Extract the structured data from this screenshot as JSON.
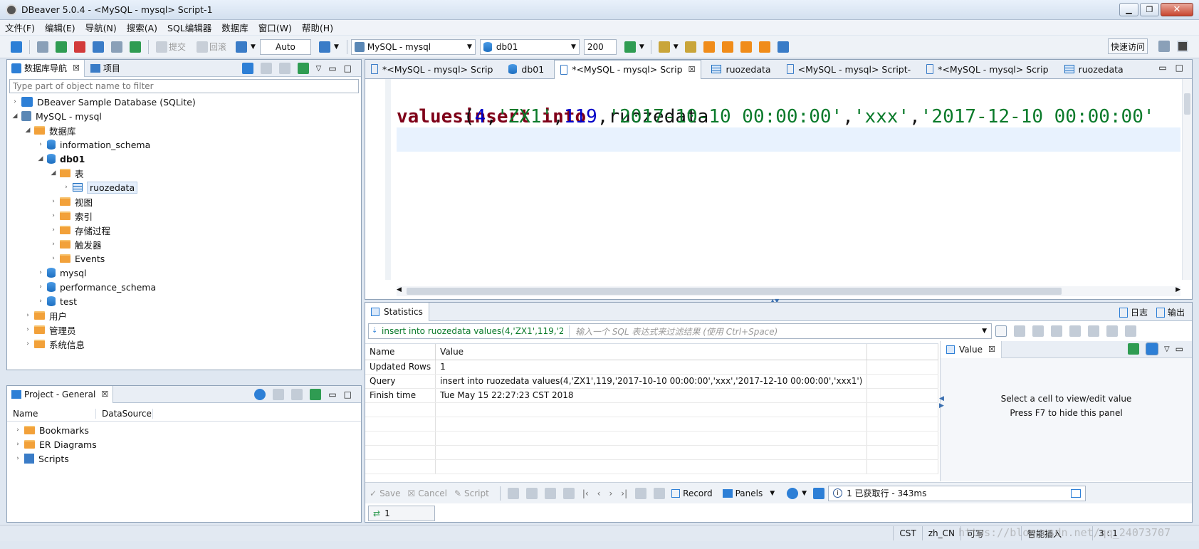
{
  "window": {
    "title": "DBeaver 5.0.4 - <MySQL - mysql> Script-1"
  },
  "menu": [
    "文件(F)",
    "编辑(E)",
    "导航(N)",
    "搜索(A)",
    "SQL编辑器",
    "数据库",
    "窗口(W)",
    "帮助(H)"
  ],
  "toolbar": {
    "commit_label": "提交",
    "rollback_label": "回滚",
    "tx_mode": "Auto",
    "connection": "MySQL - mysql",
    "database": "db01",
    "limit": "200",
    "quick_access": "快速访问"
  },
  "navigator": {
    "tab_label": "数据库导航",
    "tab2_label": "项目",
    "filter_placeholder": "Type part of object name to filter",
    "tree": [
      {
        "label": "DBeaver Sample Database (SQLite)",
        "icon": "sqlite-icon",
        "twisty": "›",
        "indent": 0,
        "bold": false
      },
      {
        "label": "MySQL - mysql",
        "icon": "mysql-connection-icon",
        "twisty": "◢",
        "indent": 0,
        "bold": false
      },
      {
        "label": "数据库",
        "icon": "folder-icon",
        "twisty": "◢",
        "indent": 1,
        "bold": false
      },
      {
        "label": "information_schema",
        "icon": "database-icon",
        "twisty": "›",
        "indent": 2,
        "bold": false
      },
      {
        "label": "db01",
        "icon": "database-icon",
        "twisty": "◢",
        "indent": 2,
        "bold": true
      },
      {
        "label": "表",
        "icon": "table-folder-icon",
        "twisty": "◢",
        "indent": 3,
        "bold": false
      },
      {
        "label": "ruozedata",
        "icon": "table-icon",
        "twisty": "›",
        "indent": 4,
        "bold": false,
        "selected": true
      },
      {
        "label": "视图",
        "icon": "view-folder-icon",
        "twisty": "›",
        "indent": 3,
        "bold": false
      },
      {
        "label": "索引",
        "icon": "folder-icon",
        "twisty": "›",
        "indent": 3,
        "bold": false
      },
      {
        "label": "存储过程",
        "icon": "folder-icon",
        "twisty": "›",
        "indent": 3,
        "bold": false
      },
      {
        "label": "触发器",
        "icon": "folder-icon",
        "twisty": "›",
        "indent": 3,
        "bold": false
      },
      {
        "label": "Events",
        "icon": "folder-icon",
        "twisty": "›",
        "indent": 3,
        "bold": false
      },
      {
        "label": "mysql",
        "icon": "database-icon",
        "twisty": "›",
        "indent": 2,
        "bold": false
      },
      {
        "label": "performance_schema",
        "icon": "database-icon",
        "twisty": "›",
        "indent": 2,
        "bold": false
      },
      {
        "label": "test",
        "icon": "database-icon",
        "twisty": "›",
        "indent": 2,
        "bold": false
      },
      {
        "label": "用户",
        "icon": "folder-icon",
        "twisty": "›",
        "indent": 1,
        "bold": false
      },
      {
        "label": "管理员",
        "icon": "folder-icon",
        "twisty": "›",
        "indent": 1,
        "bold": false
      },
      {
        "label": "系统信息",
        "icon": "folder-icon",
        "twisty": "›",
        "indent": 1,
        "bold": false
      }
    ]
  },
  "project": {
    "tab_label": "Project - General",
    "col_name": "Name",
    "col_datasource": "DataSource",
    "items": [
      {
        "label": "Bookmarks",
        "icon": "bookmarks-folder-icon"
      },
      {
        "label": "ER Diagrams",
        "icon": "er-diagrams-folder-icon"
      },
      {
        "label": "Scripts",
        "icon": "scripts-folder-icon"
      }
    ]
  },
  "editor": {
    "tabs": [
      {
        "label": "*<MySQL - mysql> Scrip",
        "icon": "script-icon",
        "active": false
      },
      {
        "label": "db01",
        "icon": "database-icon",
        "active": false
      },
      {
        "label": "*<MySQL - mysql> Scrip",
        "icon": "script-icon",
        "active": true
      },
      {
        "label": "ruozedata",
        "icon": "table-icon",
        "active": false
      },
      {
        "label": "<MySQL - mysql> Script-",
        "icon": "script-icon",
        "active": false
      },
      {
        "label": "*<MySQL - mysql> Scrip",
        "icon": "script-icon",
        "active": false
      },
      {
        "label": "ruozedata",
        "icon": "table-icon",
        "active": false
      }
    ],
    "line1_kw1": "insert",
    "line1_kw2": "into",
    "line1_ident": "ruozedata",
    "line2_kw": "values",
    "line2_paren": "(",
    "line2_v1": "4",
    "line2_comma": ",",
    "line2_v2": "'ZX1'",
    "line2_v3": "119",
    "line2_v4": "'2017-10-10 00:00:00'",
    "line2_v5": "'xxx'",
    "line2_v6": "'2017-12-10 00:00:00'"
  },
  "results": {
    "tab_label": "Statistics",
    "log_label": "日志",
    "output_label": "输出",
    "query_preview": "insert into ruozedata values(4,'ZX1',119,'2017",
    "filter_placeholder": "输入一个 SQL 表达式来过滤结果 (使用 Ctrl+Space)",
    "columns": [
      "Name",
      "Value"
    ],
    "rows": [
      [
        "Updated Rows",
        "1"
      ],
      [
        "Query",
        "insert into  ruozedata values(4,'ZX1',119,'2017-10-10 00:00:00','xxx','2017-12-10 00:00:00','xxx1')"
      ],
      [
        "Finish time",
        "Tue May 15 22:27:23 CST 2018"
      ],
      [
        "",
        ""
      ],
      [
        "",
        ""
      ],
      [
        "",
        ""
      ],
      [
        "",
        ""
      ],
      [
        "",
        ""
      ]
    ],
    "value_panel": {
      "tab_label": "Value",
      "hint1": "Select a cell to view/edit value",
      "hint2": "Press F7 to hide this panel"
    },
    "bottom": {
      "save": "Save",
      "cancel": "Cancel",
      "script": "Script",
      "record": "Record",
      "panels": "Panels",
      "status": "1 已获取行 - 343ms",
      "result_tab": "1"
    }
  },
  "statusbar": {
    "tz": "CST",
    "locale": "zh_CN",
    "writable": "可写",
    "insert_mode": "智能插入",
    "position": "3 : 1"
  },
  "watermark": "https://blog.csdn.net/qq_24073707"
}
